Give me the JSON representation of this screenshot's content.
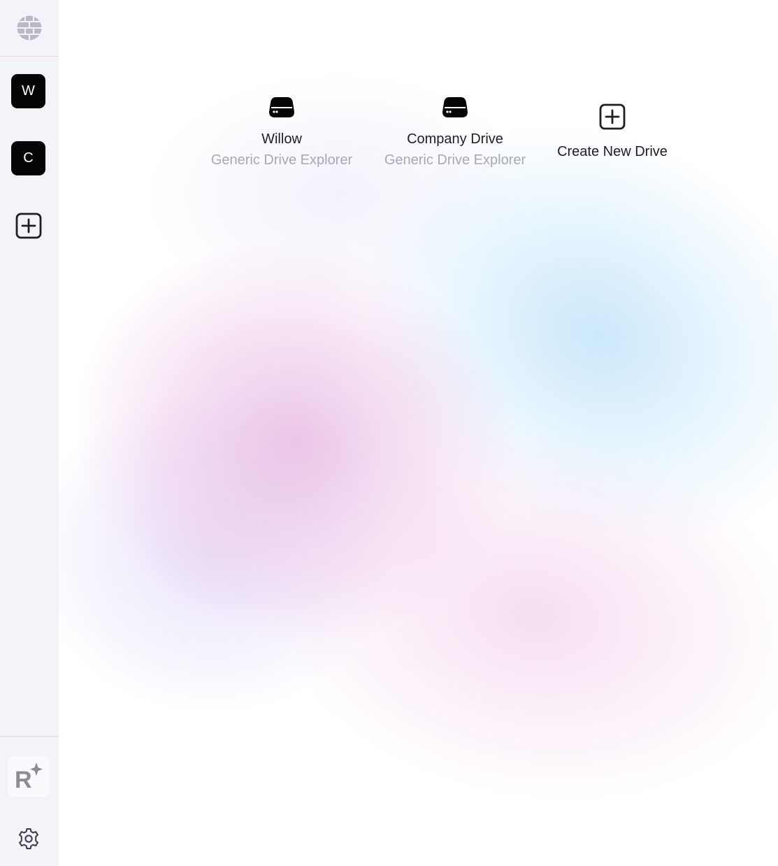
{
  "sidebar": {
    "drives": [
      {
        "initial": "W"
      },
      {
        "initial": "C"
      }
    ],
    "logo_letter": "R"
  },
  "main": {
    "drives": [
      {
        "name": "Willow",
        "type": "Generic Drive Explorer"
      },
      {
        "name": "Company Drive",
        "type": "Generic Drive Explorer"
      }
    ],
    "create": {
      "label": "Create New Drive"
    }
  },
  "icons": {
    "top": "globe-icon",
    "add": "plus-square-icon",
    "drive": "hard-drive-icon",
    "assistant": "r-sparkle-logo-icon",
    "settings": "gear-icon"
  },
  "colors": {
    "sidebar_bg": "#f3f3fa",
    "drive_tile_bg": "#050505",
    "text_primary": "#1e1e24",
    "text_secondary": "#a8a8b3",
    "divider": "#e6d6e6"
  }
}
